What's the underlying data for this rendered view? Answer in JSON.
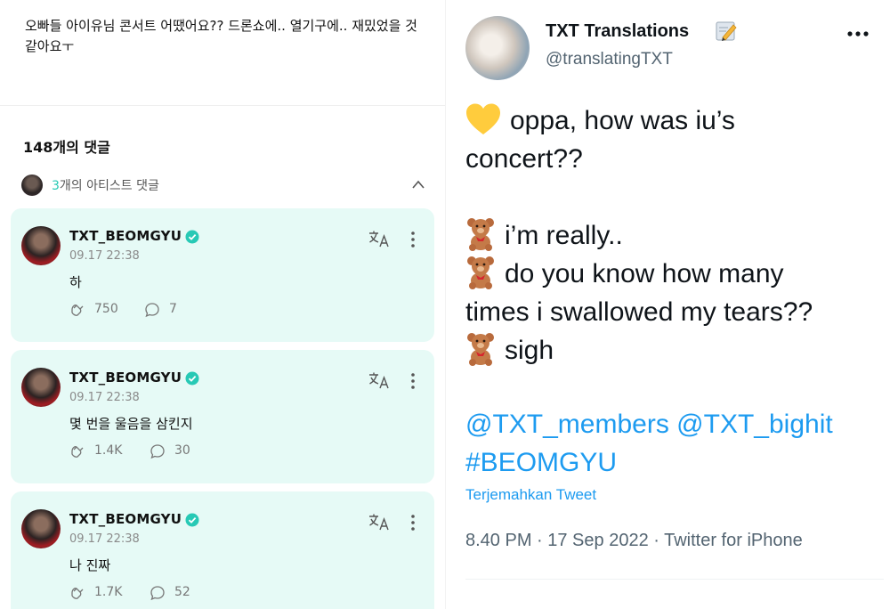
{
  "weverse": {
    "post_text": "오빠들 아이유님 콘서트 어땠어요?? 드론쇼에.. 열기구에.. 재밌었을 것 같아요ㅜ",
    "comment_count_label": "148개의 댓글",
    "artist_comments": {
      "count": "3",
      "suffix": "개의 아티스트 댓글"
    },
    "comments": [
      {
        "author": "TXT_BEOMGYU",
        "time": "09.17 22:38",
        "text": "하",
        "likes": "750",
        "replies": "7"
      },
      {
        "author": "TXT_BEOMGYU",
        "time": "09.17 22:38",
        "text": "몇 번을 울음을 삼킨지",
        "likes": "1.4K",
        "replies": "30"
      },
      {
        "author": "TXT_BEOMGYU",
        "time": "09.17 22:38",
        "text": "나 진짜",
        "likes": "1.7K",
        "replies": "52"
      }
    ],
    "accent_color": "#27c9b5",
    "card_color": "#e6faf6"
  },
  "tweet": {
    "display_name": "TXT Translations",
    "handle": "@translatingTXT",
    "lines": {
      "l1": "oppa, how was iu’s",
      "l2": "concert??",
      "l3": "i’m really..",
      "l4": "do you know how many",
      "l5": "times i swallowed my tears??",
      "l6": "sigh"
    },
    "mentions": {
      "m1": "@TXT_members",
      "m2": "@TXT_bighit",
      "tag": "#BEOMGYU"
    },
    "translate_link": "Terjemahkan Tweet",
    "meta": "8.40 PM · 17 Sep 2022 · Twitter for iPhone",
    "icons": [
      "yellow-heart-icon",
      "teddy-bear-icon",
      "pencil-memo-icon",
      "more-horizontal-icon"
    ],
    "link_color": "#1d9bf0"
  }
}
